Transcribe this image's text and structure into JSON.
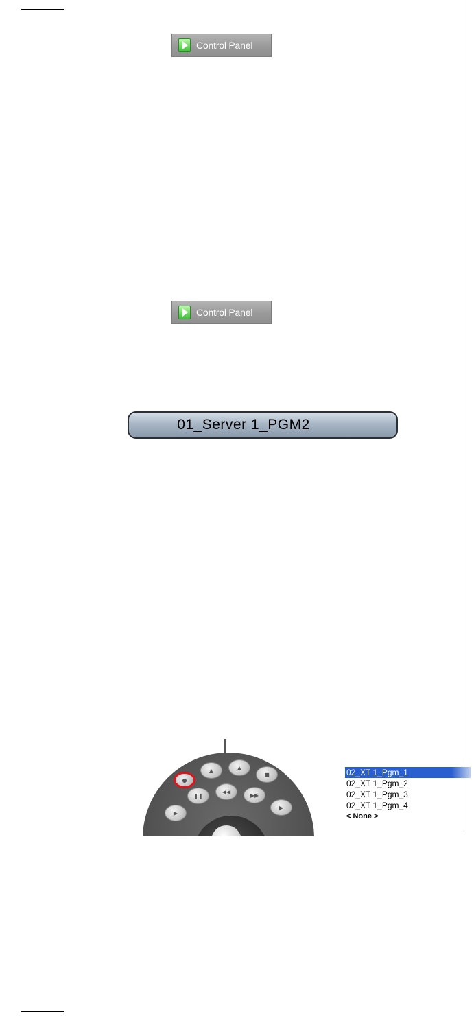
{
  "control_panel_label": "Control Panel",
  "server_channel": "01_Server 1_PGM2",
  "channels": [
    "02_XT 1_Pgm_1",
    "02_XT 1_Pgm_2",
    "02_XT 1_Pgm_3",
    "02_XT 1_Pgm_4",
    "< None >"
  ],
  "selected_channel": "02_XT 1_Pgm_1",
  "colors": {
    "selection": "#2a5fcf",
    "highlight_ring": "#e0141c",
    "button_icon": "#3fbf3a"
  }
}
